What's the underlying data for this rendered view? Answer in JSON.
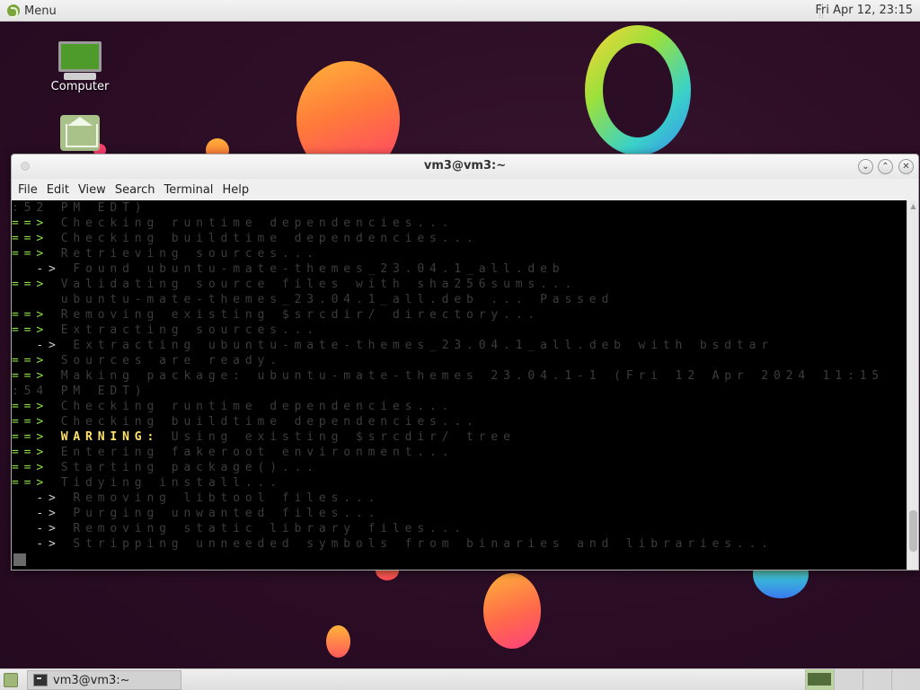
{
  "top_panel": {
    "menu_label": "Menu",
    "clock": "Fri Apr 12, 23:15"
  },
  "desktop": {
    "icons": [
      {
        "label": "Computer"
      },
      {
        "label": ""
      }
    ]
  },
  "window": {
    "title": "vm3@vm3:~",
    "menus": [
      "File",
      "Edit",
      "View",
      "Search",
      "Terminal",
      "Help"
    ]
  },
  "terminal": {
    "lines": [
      {
        "arrow": "",
        "text": ":52 PM EDT)",
        "kind": "dim"
      },
      {
        "arrow": "==>",
        "text": " Checking runtime dependencies...",
        "kind": "dim"
      },
      {
        "arrow": "==>",
        "text": " Checking buildtime dependencies...",
        "kind": "dim"
      },
      {
        "arrow": "==>",
        "text": " Retrieving sources...",
        "kind": "dim"
      },
      {
        "arrow": "  ->",
        "text": " Found ubuntu-mate-themes_23.04.1_all.deb",
        "kind": "sub"
      },
      {
        "arrow": "==>",
        "text": " Validating source files with sha256sums...",
        "kind": "dim"
      },
      {
        "arrow": "",
        "text": "    ubuntu-mate-themes_23.04.1_all.deb ... Passed",
        "kind": "dim"
      },
      {
        "arrow": "==>",
        "text": " Removing existing $srcdir/ directory...",
        "kind": "dim"
      },
      {
        "arrow": "==>",
        "text": " Extracting sources...",
        "kind": "dim"
      },
      {
        "arrow": "  ->",
        "text": " Extracting ubuntu-mate-themes_23.04.1_all.deb with bsdtar",
        "kind": "sub"
      },
      {
        "arrow": "==>",
        "text": " Sources are ready.",
        "kind": "dim"
      },
      {
        "arrow": "==>",
        "text": " Making package: ubuntu-mate-themes 23.04.1-1 (Fri 12 Apr 2024 11:15",
        "kind": "dim"
      },
      {
        "arrow": "",
        "text": ":54 PM EDT)",
        "kind": "dim"
      },
      {
        "arrow": "==>",
        "text": " Checking runtime dependencies...",
        "kind": "dim"
      },
      {
        "arrow": "==>",
        "text": " Checking buildtime dependencies...",
        "kind": "dim"
      },
      {
        "arrow": "==>",
        "text": " WARNING:",
        "kind": "warn",
        "rest": " Using existing $srcdir/ tree"
      },
      {
        "arrow": "==>",
        "text": " Entering fakeroot environment...",
        "kind": "dim"
      },
      {
        "arrow": "==>",
        "text": " Starting package()...",
        "kind": "dim"
      },
      {
        "arrow": "==>",
        "text": " Tidying install...",
        "kind": "dim"
      },
      {
        "arrow": "  ->",
        "text": " Removing libtool files...",
        "kind": "sub"
      },
      {
        "arrow": "  ->",
        "text": " Purging unwanted files...",
        "kind": "sub"
      },
      {
        "arrow": "  ->",
        "text": " Removing static library files...",
        "kind": "sub"
      },
      {
        "arrow": "  ->",
        "text": " Stripping unneeded symbols from binaries and libraries...",
        "kind": "sub"
      }
    ]
  },
  "taskbar": {
    "task_label": "vm3@vm3:~",
    "workspaces": 4
  }
}
